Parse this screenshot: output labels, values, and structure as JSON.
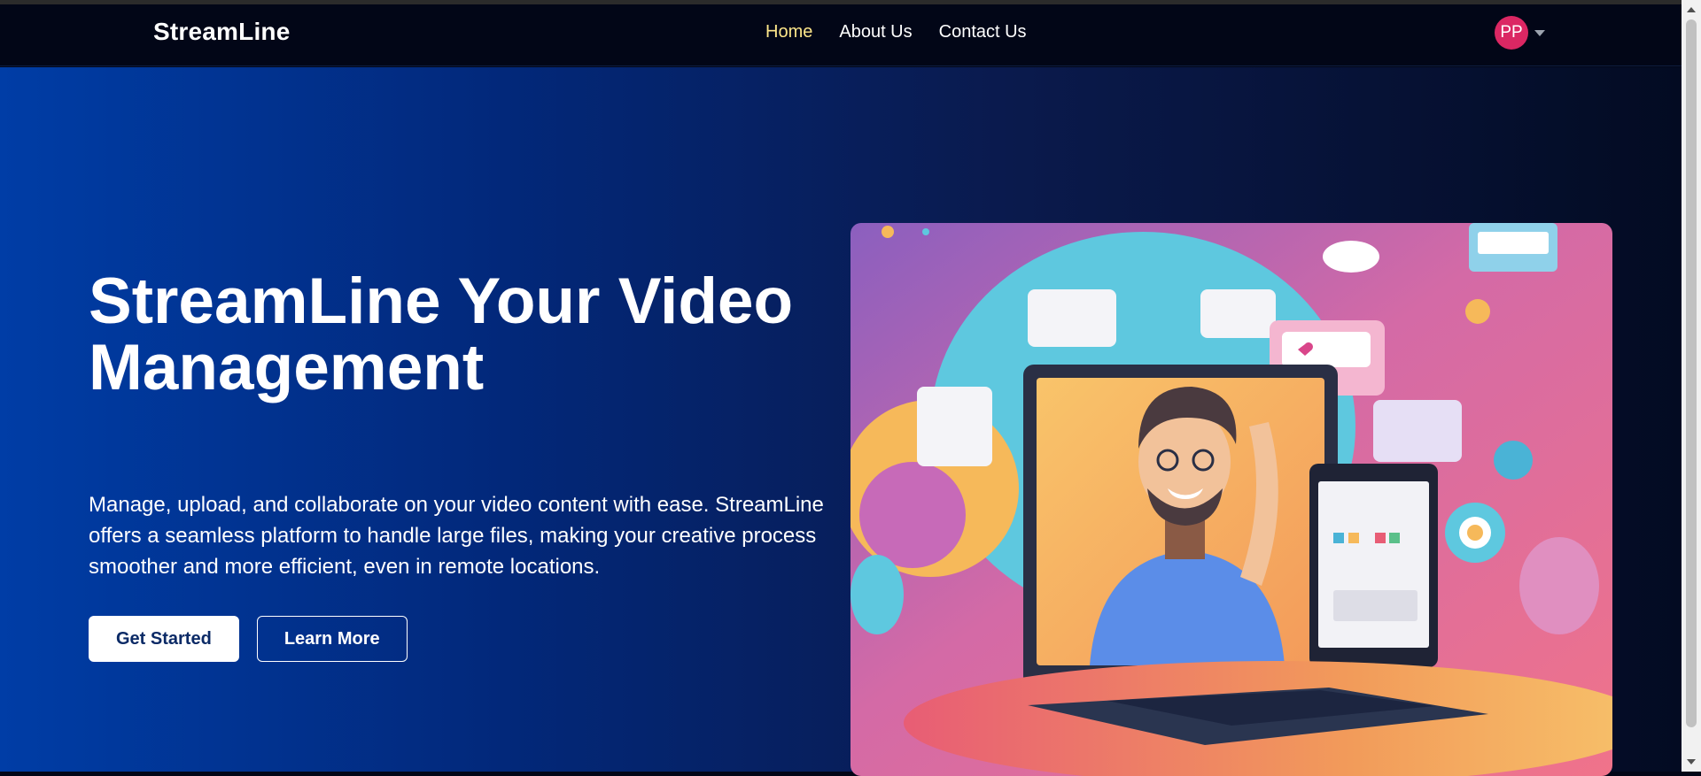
{
  "brand": {
    "name": "StreamLine"
  },
  "nav": {
    "links": [
      {
        "label": "Home",
        "active": true
      },
      {
        "label": "About Us",
        "active": false
      },
      {
        "label": "Contact Us",
        "active": false
      }
    ]
  },
  "user": {
    "initials": "PP",
    "avatar_color": "#db2763",
    "menu_icon": "chevron-down-icon"
  },
  "hero": {
    "title": "StreamLine Your Video Management",
    "description": "Manage, upload, and collaborate on your video content with ease. StreamLine offers a seamless platform to handle large files, making your creative process smoother and more efficient, even in remote locations.",
    "primary_button": "Get Started",
    "secondary_button": "Learn More",
    "illustration": "video-creator-illustration"
  },
  "colors": {
    "navbar_bg": "#020617",
    "active_link": "#fde68a",
    "hero_gradient_start": "#003da6",
    "hero_gradient_end": "#030b22",
    "primary_button_text": "#0b2a66"
  }
}
